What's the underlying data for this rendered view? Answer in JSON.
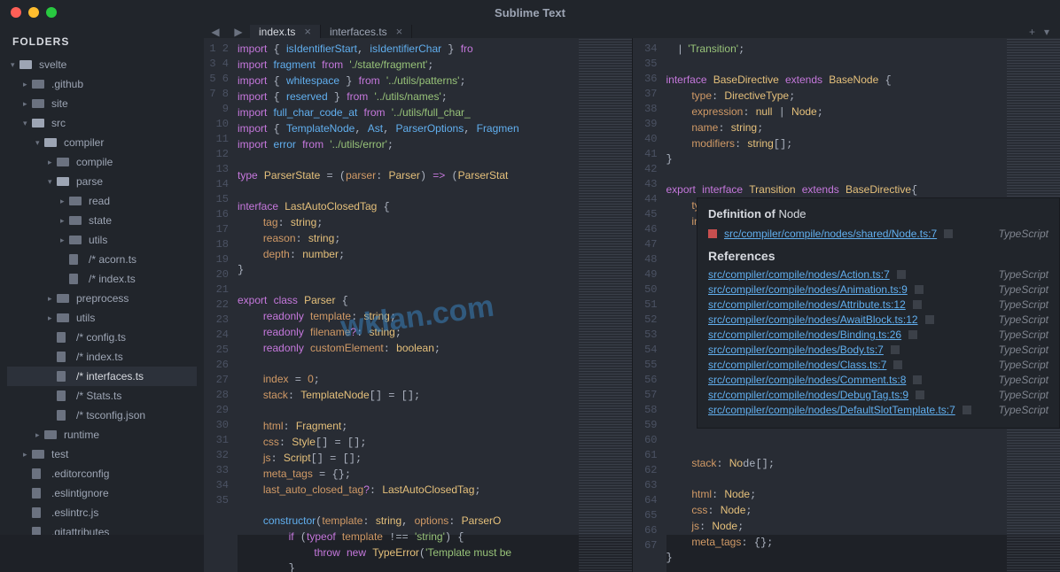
{
  "title": "Sublime Text",
  "sidebar": {
    "header": "FOLDERS",
    "tree": [
      {
        "l": 0,
        "c": "▾",
        "t": "folder",
        "open": true,
        "name": "svelte"
      },
      {
        "l": 1,
        "c": "▸",
        "t": "folder",
        "name": ".github"
      },
      {
        "l": 1,
        "c": "▸",
        "t": "folder",
        "name": "site"
      },
      {
        "l": 1,
        "c": "▾",
        "t": "folder",
        "open": true,
        "name": "src"
      },
      {
        "l": 2,
        "c": "▾",
        "t": "folder",
        "open": true,
        "name": "compiler"
      },
      {
        "l": 3,
        "c": "▸",
        "t": "folder",
        "name": "compile"
      },
      {
        "l": 3,
        "c": "▾",
        "t": "folder",
        "open": true,
        "name": "parse"
      },
      {
        "l": 4,
        "c": "▸",
        "t": "folder",
        "name": "read"
      },
      {
        "l": 4,
        "c": "▸",
        "t": "folder",
        "name": "state"
      },
      {
        "l": 4,
        "c": "▸",
        "t": "folder",
        "name": "utils"
      },
      {
        "l": 4,
        "c": "",
        "t": "file",
        "name": "/* acorn.ts"
      },
      {
        "l": 4,
        "c": "",
        "t": "file",
        "name": "/* index.ts"
      },
      {
        "l": 3,
        "c": "▸",
        "t": "folder",
        "name": "preprocess"
      },
      {
        "l": 3,
        "c": "▸",
        "t": "folder",
        "name": "utils"
      },
      {
        "l": 3,
        "c": "",
        "t": "file",
        "name": "/* config.ts"
      },
      {
        "l": 3,
        "c": "",
        "t": "file",
        "name": "/* index.ts"
      },
      {
        "l": 3,
        "c": "",
        "t": "file",
        "name": "/* interfaces.ts",
        "sel": true
      },
      {
        "l": 3,
        "c": "",
        "t": "file",
        "name": "/* Stats.ts"
      },
      {
        "l": 3,
        "c": "",
        "t": "file",
        "name": "/* tsconfig.json"
      },
      {
        "l": 2,
        "c": "▸",
        "t": "folder",
        "name": "runtime"
      },
      {
        "l": 1,
        "c": "▸",
        "t": "folder",
        "name": "test"
      },
      {
        "l": 1,
        "c": "",
        "t": "file",
        "name": ".editorconfig"
      },
      {
        "l": 1,
        "c": "",
        "t": "file",
        "name": ".eslintignore"
      },
      {
        "l": 1,
        "c": "",
        "t": "file",
        "name": ".eslintrc.js"
      },
      {
        "l": 1,
        "c": "",
        "t": "file",
        "name": ".gitattributes"
      }
    ]
  },
  "tabs": [
    {
      "name": "index.ts",
      "active": true
    },
    {
      "name": "interfaces.ts",
      "active": false
    }
  ],
  "pane1": {
    "start": 1,
    "lines": [
      "<span class='k'>import</span> { <span class='f'>isIdentifierStart</span>, <span class='f'>isIdentifierChar</span> } <span class='k'>fro</span>",
      "<span class='k'>import</span> <span class='f'>fragment</span> <span class='k'>from</span> <span class='s'>'./state/fragment'</span>;",
      "<span class='k'>import</span> { <span class='f'>whitespace</span> } <span class='k'>from</span> <span class='s'>'../utils/patterns'</span>;",
      "<span class='k'>import</span> { <span class='f'>reserved</span> } <span class='k'>from</span> <span class='s'>'../utils/names'</span>;",
      "<span class='k'>import</span> <span class='f'>full_char_code_at</span> <span class='k'>from</span> <span class='s'>'../utils/full_char_</span>",
      "<span class='k'>import</span> { <span class='f'>TemplateNode</span>, <span class='f'>Ast</span>, <span class='f'>ParserOptions</span>, <span class='f'>Fragmen</span>",
      "<span class='k'>import</span> <span class='f'>error</span> <span class='k'>from</span> <span class='s'>'../utils/error'</span>;",
      "",
      "<span class='k'>type</span> <span class='t'>ParserState</span> = (<span class='n'>parser</span>: <span class='t'>Parser</span>) <span class='k'>=&gt;</span> (<span class='t'>ParserStat</span>",
      "",
      "<span class='k'>interface</span> <span class='t'>LastAutoClosedTag</span> {",
      "    <span class='n'>tag</span>: <span class='t'>string</span>;",
      "    <span class='n'>reason</span>: <span class='t'>string</span>;",
      "    <span class='n'>depth</span>: <span class='t'>number</span>;",
      "}",
      "",
      "<span class='k'>export</span> <span class='k'>class</span> <span class='t'>Parser</span> {",
      "    <span class='k'>readonly</span> <span class='n'>template</span>: <span class='t'>string</span>;",
      "    <span class='k'>readonly</span> <span class='n'>filename</span><span class='k'>?</span>: <span class='t'>string</span>;",
      "    <span class='k'>readonly</span> <span class='n'>customElement</span>: <span class='t'>boolean</span>;",
      "",
      "    <span class='n'>index</span> = <span class='n'>0</span>;",
      "    <span class='n'>stack</span>: <span class='t'>TemplateNode</span>[] = [];",
      "",
      "    <span class='n'>html</span>: <span class='t'>Fragment</span>;",
      "    <span class='n'>css</span>: <span class='t'>Style</span>[] = [];",
      "    <span class='n'>js</span>: <span class='t'>Script</span>[] = [];",
      "    <span class='n'>meta_tags</span> = {};",
      "    <span class='n'>last_auto_closed_tag</span><span class='k'>?</span>: <span class='t'>LastAutoClosedTag</span>;",
      "",
      "    <span class='f'>constructor</span>(<span class='n'>template</span>: <span class='t'>string</span>, <span class='n'>options</span>: <span class='t'>ParserO</span>",
      "        <span class='k'>if</span> (<span class='k'>typeof</span> <span class='n'>template</span> !== <span class='s'>'string'</span>) {",
      "            <span class='k'>throw</span> <span class='k'>new</span> <span class='t'>TypeError</span>(<span class='s'>'Template must be </span>",
      "        }",
      ""
    ]
  },
  "pane2": {
    "start": 34,
    "lines": [
      "  <span class='p'>|</span> <span class='s'>'Transition'</span>;",
      "",
      "<span class='k'>interface</span> <span class='t'>BaseDirective</span> <span class='k'>extends</span> <span class='t'>BaseNode</span> {",
      "    <span class='n'>type</span>: <span class='t'>DirectiveType</span>;",
      "    <span class='n'>expression</span>: <span class='t'>null</span> | <span class='t'>Node</span>;",
      "    <span class='n'>name</span>: <span class='t'>string</span>;",
      "    <span class='n'>modifiers</span>: <span class='t'>string</span>[];",
      "}",
      "",
      "<span class='k'>export</span> <span class='k'>interface</span> <span class='t'>Transition</span> <span class='k'>extends</span> <span class='t'>BaseDirective</span>{",
      "    <span class='n'>type</span>: <span class='s'>'Transition'</span>;",
      "    <span class='n'>intro</span>: <span class='t'>boolean</span>;",
      "",
      "",
      "",
      "",
      "",
      "",
      "",
      "",
      "",
      "",
      "",
      "",
      "",
      "",
      "",
      "    <span class='n'>stack</span>: <span class='t'>No</span>de[];",
      "",
      "    <span class='n'>html</span>: <span class='t'>Node</span>;",
      "    <span class='n'>css</span>: <span class='t'>Node</span>;",
      "    <span class='n'>js</span>: <span class='t'>Node</span>;",
      "    <span class='n'>meta_tags</span>: {};",
      "}"
    ]
  },
  "goto": {
    "def_label": "Definition of",
    "def_word": "Node",
    "def_link": "src/compiler/compile/nodes/shared/Node.ts:7",
    "lang": "TypeScript",
    "ref_label": "References",
    "refs": [
      "src/compiler/compile/nodes/Action.ts:7",
      "src/compiler/compile/nodes/Animation.ts:9",
      "src/compiler/compile/nodes/Attribute.ts:12",
      "src/compiler/compile/nodes/AwaitBlock.ts:12",
      "src/compiler/compile/nodes/Binding.ts:26",
      "src/compiler/compile/nodes/Body.ts:7",
      "src/compiler/compile/nodes/Class.ts:7",
      "src/compiler/compile/nodes/Comment.ts:8",
      "src/compiler/compile/nodes/DebugTag.ts:9",
      "src/compiler/compile/nodes/DefaultSlotTemplate.ts:7"
    ]
  },
  "watermark": "wklan.com"
}
